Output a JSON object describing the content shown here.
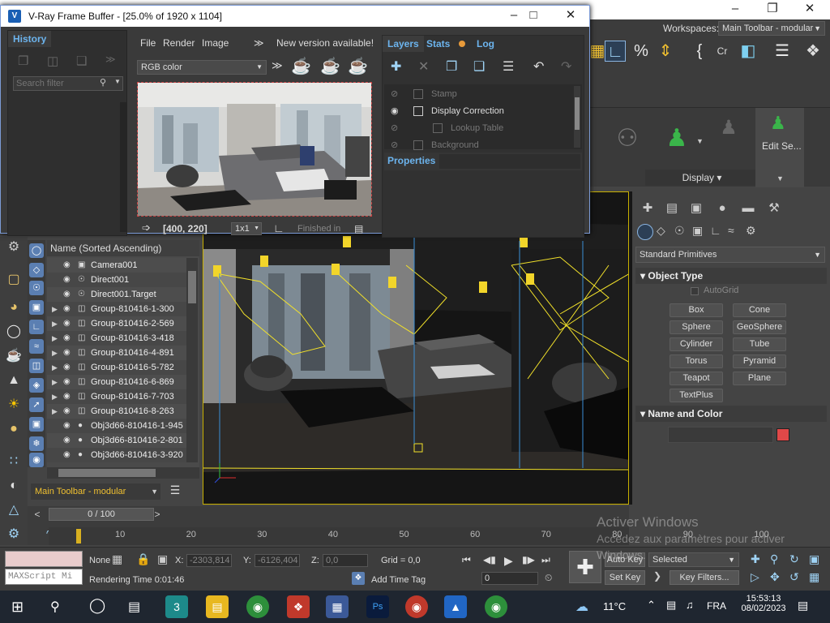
{
  "vfb": {
    "title": "V-Ray Frame Buffer - [25.0% of 1920 x 1104]",
    "icon": "V",
    "history_tab": "History",
    "search_placeholder": "Search filter",
    "menu": {
      "file": "File",
      "render": "Render",
      "image": "Image",
      "more": "≫",
      "new_version": "New version available!"
    },
    "channel": "RGB color",
    "coords": "[400, 220]",
    "zoom": "1x1",
    "status": "Finished in",
    "right_tabs": {
      "layers": "Layers",
      "stats": "Stats",
      "log": "Log"
    },
    "layers": [
      {
        "name": "Stamp",
        "dim": true
      },
      {
        "name": "Display Correction",
        "dim": false
      },
      {
        "name": "Lookup Table",
        "dim": true
      },
      {
        "name": "Background",
        "dim": true
      }
    ],
    "properties": "Properties"
  },
  "max": {
    "workspaces_label": "Workspaces:",
    "workspace_value": "Main Toolbar - modular",
    "display_label": "Display",
    "edit_label": "Edit Se...",
    "percent_label": "%"
  },
  "cmd": {
    "category": "Standard Primitives",
    "object_type": "Object Type",
    "autogrid": "AutoGrid",
    "buttons": [
      "Box",
      "Cone",
      "Sphere",
      "GeoSphere",
      "Cylinder",
      "Tube",
      "Torus",
      "Pyramid",
      "Teapot",
      "Plane",
      "TextPlus"
    ],
    "name_color": "Name and Color",
    "color": "#e04848"
  },
  "explorer": {
    "header": "Name (Sorted Ascending)",
    "rows": [
      {
        "name": "Camera001",
        "expand": false,
        "type": "cam"
      },
      {
        "name": "Direct001",
        "expand": false,
        "type": "light"
      },
      {
        "name": "Direct001.Target",
        "expand": false,
        "type": "light"
      },
      {
        "name": "Group-810416-1-300",
        "expand": true,
        "type": "group"
      },
      {
        "name": "Group-810416-2-569",
        "expand": true,
        "type": "group"
      },
      {
        "name": "Group-810416-3-418",
        "expand": true,
        "type": "group"
      },
      {
        "name": "Group-810416-4-891",
        "expand": true,
        "type": "group"
      },
      {
        "name": "Group-810416-5-782",
        "expand": true,
        "type": "group"
      },
      {
        "name": "Group-810416-6-869",
        "expand": true,
        "type": "group"
      },
      {
        "name": "Group-810416-7-703",
        "expand": true,
        "type": "group"
      },
      {
        "name": "Group-810416-8-263",
        "expand": true,
        "type": "group"
      },
      {
        "name": "Obj3d66-810416-1-945",
        "expand": false,
        "type": "obj"
      },
      {
        "name": "Obj3d66-810416-2-801",
        "expand": false,
        "type": "obj"
      },
      {
        "name": "Obj3d66-810416-3-920",
        "expand": false,
        "type": "obj"
      }
    ],
    "toolbar_select": "Main Toolbar - modular"
  },
  "timeline": {
    "frame": "0 / 100",
    "ticks": [
      "10",
      "20",
      "30",
      "40",
      "50",
      "60",
      "70",
      "80",
      "90",
      "100"
    ]
  },
  "status": {
    "none": "None",
    "x_label": "X:",
    "x_value": "-2303,814",
    "y_label": "Y:",
    "y_value": "-6126,404",
    "z_label": "Z:",
    "z_value": "0,0",
    "grid": "Grid = 0,0",
    "add_time_tag": "Add Time Tag",
    "maxscript": "MAXScript Mi",
    "rendering_time": "Rendering Time  0:01:46",
    "auto_key": "Auto Key",
    "selected": "Selected",
    "set_key": "Set Key",
    "key_filters": "Key Filters...",
    "frame_field": "0"
  },
  "windows_activation": {
    "title": "Activer Windows",
    "subtitle": "Accédez aux paramètres pour activer",
    "subtitle2": "Windows."
  },
  "taskbar": {
    "weather": "11°C",
    "language": "FRA",
    "time": "15:53:13",
    "date": "08/02/2023"
  }
}
